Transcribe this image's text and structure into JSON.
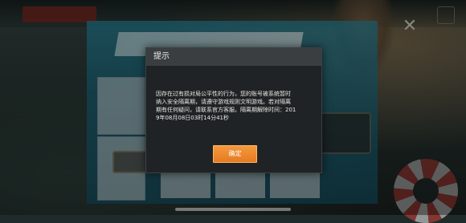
{
  "dialog": {
    "title": "提示",
    "message": "因存在过有损对局公平性的行为，您的账号被系统暂时\n纳入安全隔离期，请遵守游戏规则文明游戏。若对隔离\n期有任何疑问，请联系官方客服。隔离期解除时间：201\n9年08月08日03时14分41秒",
    "confirm_label": "确定"
  },
  "icons": {
    "close": "close-icon"
  },
  "colors": {
    "confirm_button": "#f08a30",
    "dialog_bg": "#202325",
    "dialog_header": "#3a3e41"
  }
}
